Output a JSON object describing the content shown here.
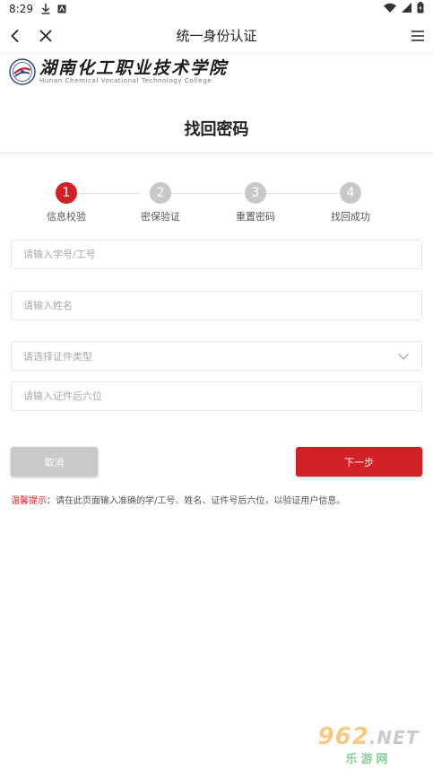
{
  "status_bar": {
    "time": "8:29"
  },
  "nav": {
    "title": "统一身份认证"
  },
  "logo": {
    "name_cn": "湖南化工职业技术学院",
    "name_en": "Hunan Chemical Vocational Technology College"
  },
  "page": {
    "title": "找回密码"
  },
  "steps": [
    {
      "number": "1",
      "label": "信息校验",
      "active": true
    },
    {
      "number": "2",
      "label": "密保验证",
      "active": false
    },
    {
      "number": "3",
      "label": "重置密码",
      "active": false
    },
    {
      "number": "4",
      "label": "找回成功",
      "active": false
    }
  ],
  "form": {
    "student_id_placeholder": "请输入学号/工号",
    "name_placeholder": "请输入姓名",
    "id_type_placeholder": "请选择证件类型",
    "id_last6_placeholder": "请输入证件后六位"
  },
  "buttons": {
    "cancel": "取消",
    "next": "下一步"
  },
  "tip": {
    "label": "温馨提示：",
    "text": "请在此页面输入准确的学/工号、姓名、证件号后六位，以验证用户信息。"
  },
  "watermark": {
    "top": "962",
    "suffix": ".NET",
    "bottom": "乐游网"
  },
  "colors": {
    "accent": "#d22027",
    "step_inactive": "#c8c8c8",
    "cancel_bg": "#c9c9c9"
  }
}
